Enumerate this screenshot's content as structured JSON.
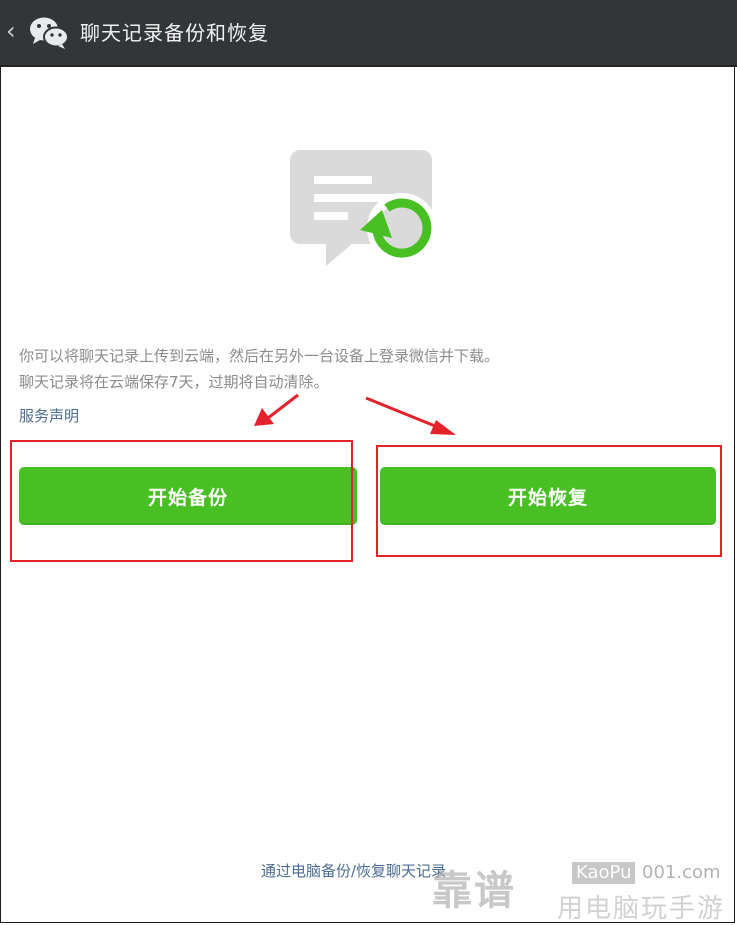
{
  "header": {
    "title": "聊天记录备份和恢复",
    "back_icon": "chevron-left-icon",
    "logo_icon": "wechat-logo-icon",
    "bg_color": "#333639"
  },
  "hero": {
    "icon": "chat-restore-icon",
    "accent_color": "#48c024"
  },
  "description": {
    "line1": "你可以将聊天记录上传到云端，然后在另外一台设备上登录微信并下载。",
    "line2": "聊天记录将在云端保存7天，过期将自动清除。"
  },
  "service_link": "服务声明",
  "buttons": {
    "backup": "开始备份",
    "restore": "开始恢复",
    "color": "#48c024"
  },
  "annotations": {
    "color": "#e3222b"
  },
  "footer": {
    "link": "通过电脑备份/恢复聊天记录"
  },
  "watermark": {
    "line1_cn": "靠谱",
    "brand": "KaoPu",
    "domain": "001.com",
    "line2": "用电脑玩手游"
  }
}
